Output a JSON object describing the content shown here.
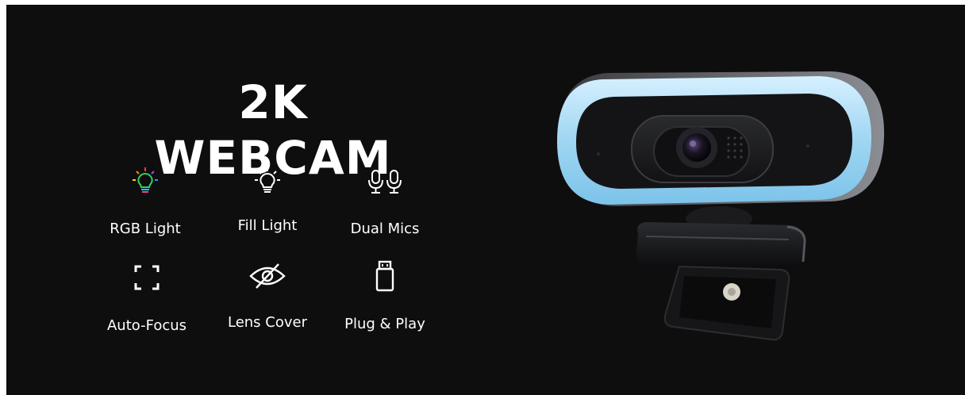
{
  "title": "2K WEBCAM",
  "features": [
    {
      "label": "RGB Light",
      "icon": "rgb-bulb-icon"
    },
    {
      "label": "Fill Light",
      "icon": "bulb-icon"
    },
    {
      "label": "Dual Mics",
      "icon": "dual-mic-icon"
    },
    {
      "label": "Auto-Focus",
      "icon": "focus-frame-icon"
    },
    {
      "label": "Lens Cover",
      "icon": "eye-off-icon"
    },
    {
      "label": "Plug & Play",
      "icon": "usb-drive-icon"
    }
  ],
  "colors": {
    "background": "#0e0e0f",
    "text": "#ffffff",
    "ring_light": "#9fd6f2"
  }
}
